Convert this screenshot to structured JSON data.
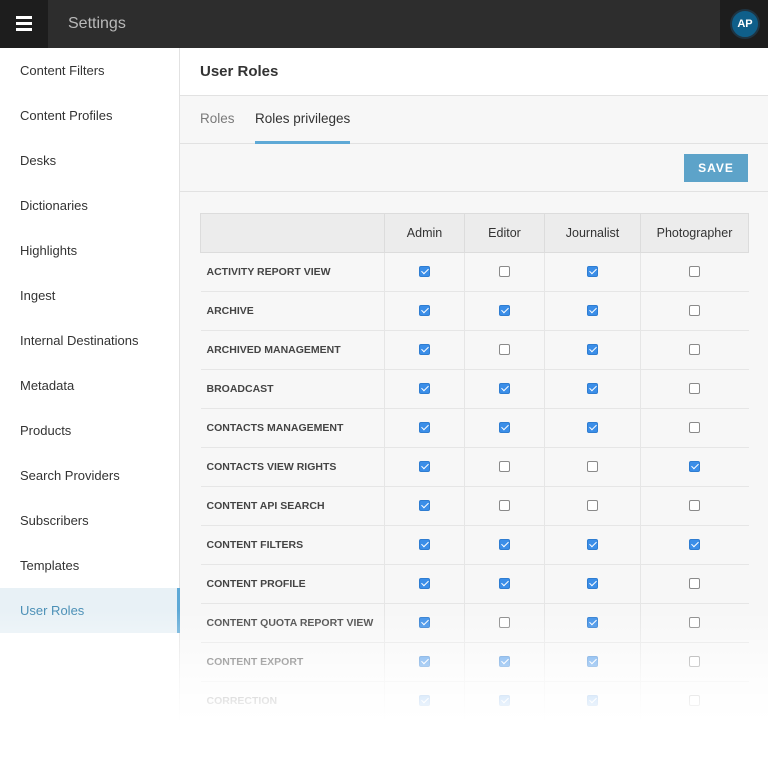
{
  "topbar": {
    "title": "Settings",
    "avatar_initials": "AP"
  },
  "sidebar": {
    "items": [
      {
        "label": "Content Filters"
      },
      {
        "label": "Content Profiles"
      },
      {
        "label": "Desks"
      },
      {
        "label": "Dictionaries"
      },
      {
        "label": "Highlights"
      },
      {
        "label": "Ingest"
      },
      {
        "label": "Internal Destinations"
      },
      {
        "label": "Metadata"
      },
      {
        "label": "Products"
      },
      {
        "label": "Search Providers"
      },
      {
        "label": "Subscribers"
      },
      {
        "label": "Templates"
      },
      {
        "label": "User Roles",
        "active": true
      }
    ]
  },
  "main": {
    "title": "User Roles",
    "tabs": [
      {
        "label": "Roles",
        "active": false
      },
      {
        "label": "Roles privileges",
        "active": true
      }
    ],
    "save_label": "SAVE",
    "table": {
      "columns": [
        "",
        "Admin",
        "Editor",
        "Journalist",
        "Photographer"
      ],
      "rows": [
        {
          "privilege": "ACTIVITY REPORT VIEW",
          "values": [
            true,
            false,
            true,
            false
          ]
        },
        {
          "privilege": "ARCHIVE",
          "values": [
            true,
            true,
            true,
            false
          ]
        },
        {
          "privilege": "ARCHIVED MANAGEMENT",
          "values": [
            true,
            false,
            true,
            false
          ]
        },
        {
          "privilege": "BROADCAST",
          "values": [
            true,
            true,
            true,
            false
          ]
        },
        {
          "privilege": "CONTACTS MANAGEMENT",
          "values": [
            true,
            true,
            true,
            false
          ]
        },
        {
          "privilege": "CONTACTS VIEW RIGHTS",
          "values": [
            true,
            false,
            false,
            true
          ]
        },
        {
          "privilege": "CONTENT API SEARCH",
          "values": [
            true,
            false,
            false,
            false
          ]
        },
        {
          "privilege": "CONTENT FILTERS",
          "values": [
            true,
            true,
            true,
            true
          ]
        },
        {
          "privilege": "CONTENT PROFILE",
          "values": [
            true,
            true,
            true,
            false
          ]
        },
        {
          "privilege": "CONTENT QUOTA REPORT VIEW",
          "values": [
            true,
            false,
            true,
            false
          ]
        },
        {
          "privilege": "CONTENT EXPORT",
          "values": [
            true,
            true,
            true,
            false
          ]
        },
        {
          "privilege": "CORRECTION",
          "values": [
            true,
            true,
            true,
            false
          ]
        }
      ]
    }
  },
  "colors": {
    "topbar_bg": "#2d2d2d",
    "accent": "#5ea9d6",
    "save_button": "#5da3c9",
    "checkbox_checked": "#3b8ee8",
    "avatar_bg": "#0f5f8a"
  },
  "icons": {
    "menu": "hamburger-icon",
    "checkbox_checked": "checkbox-checked-icon",
    "checkbox_unchecked": "checkbox-unchecked-icon"
  }
}
